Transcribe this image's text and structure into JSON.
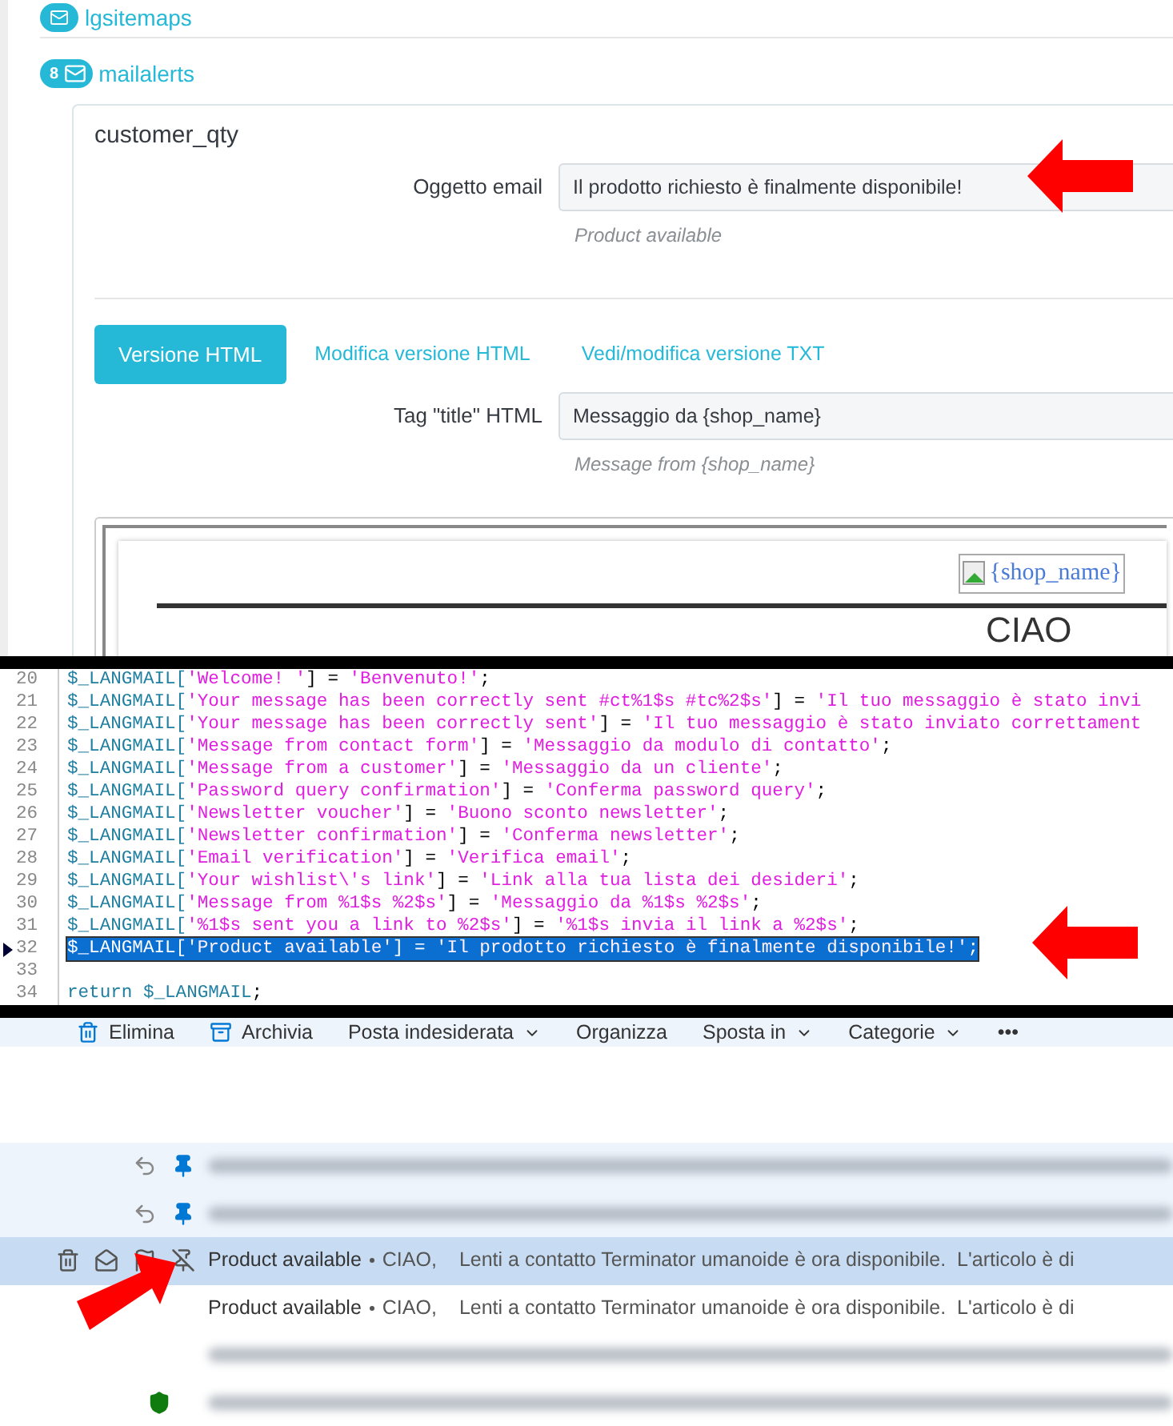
{
  "admin": {
    "modules": [
      {
        "name": "lgsitemaps"
      },
      {
        "name": "mailalerts",
        "count": "8"
      }
    ],
    "template": "customer_qty",
    "subject": {
      "label": "Oggetto email",
      "value": "Il prodotto richiesto è finalmente disponibile!",
      "hint": "Product available"
    },
    "tabs": [
      {
        "label": "Versione HTML",
        "selected": true
      },
      {
        "label": "Modifica versione HTML",
        "selected": false
      },
      {
        "label": "Vedi/modifica versione TXT",
        "selected": false
      }
    ],
    "title_tag": {
      "label": "Tag \"title\" HTML",
      "value": "Messaggio da {shop_name}",
      "hint": "Message from {shop_name}"
    },
    "preview": {
      "image_alt": "{shop_name}",
      "heading": "CIAO"
    }
  },
  "code": {
    "lines": [
      {
        "number": "20",
        "selected": false,
        "tokens": [
          {
            "kind": "var",
            "text": "$_LANGMAIL["
          },
          {
            "kind": "string",
            "text": "'Welcome! '"
          },
          {
            "kind": "punct",
            "text": "] = "
          },
          {
            "kind": "string",
            "text": "'Benvenuto!'"
          },
          {
            "kind": "punct",
            "text": ";"
          }
        ]
      },
      {
        "number": "21",
        "selected": false,
        "tokens": [
          {
            "kind": "var",
            "text": "$_LANGMAIL["
          },
          {
            "kind": "string",
            "text": "'Your message has been correctly sent #ct%1$s #tc%2$s'"
          },
          {
            "kind": "punct",
            "text": "] = "
          },
          {
            "kind": "string",
            "text": "'Il tuo messaggio è stato invi"
          }
        ]
      },
      {
        "number": "22",
        "selected": false,
        "tokens": [
          {
            "kind": "var",
            "text": "$_LANGMAIL["
          },
          {
            "kind": "string",
            "text": "'Your message has been correctly sent'"
          },
          {
            "kind": "punct",
            "text": "] = "
          },
          {
            "kind": "string",
            "text": "'Il tuo messaggio è stato inviato correttament"
          }
        ]
      },
      {
        "number": "23",
        "selected": false,
        "tokens": [
          {
            "kind": "var",
            "text": "$_LANGMAIL["
          },
          {
            "kind": "string",
            "text": "'Message from contact form'"
          },
          {
            "kind": "punct",
            "text": "] = "
          },
          {
            "kind": "string",
            "text": "'Messaggio da modulo di contatto'"
          },
          {
            "kind": "punct",
            "text": ";"
          }
        ]
      },
      {
        "number": "24",
        "selected": false,
        "tokens": [
          {
            "kind": "var",
            "text": "$_LANGMAIL["
          },
          {
            "kind": "string",
            "text": "'Message from a customer'"
          },
          {
            "kind": "punct",
            "text": "] = "
          },
          {
            "kind": "string",
            "text": "'Messaggio da un cliente'"
          },
          {
            "kind": "punct",
            "text": ";"
          }
        ]
      },
      {
        "number": "25",
        "selected": false,
        "tokens": [
          {
            "kind": "var",
            "text": "$_LANGMAIL["
          },
          {
            "kind": "string",
            "text": "'Password query confirmation'"
          },
          {
            "kind": "punct",
            "text": "] = "
          },
          {
            "kind": "string",
            "text": "'Conferma password query'"
          },
          {
            "kind": "punct",
            "text": ";"
          }
        ]
      },
      {
        "number": "26",
        "selected": false,
        "tokens": [
          {
            "kind": "var",
            "text": "$_LANGMAIL["
          },
          {
            "kind": "string",
            "text": "'Newsletter voucher'"
          },
          {
            "kind": "punct",
            "text": "] = "
          },
          {
            "kind": "string",
            "text": "'Buono sconto newsletter'"
          },
          {
            "kind": "punct",
            "text": ";"
          }
        ]
      },
      {
        "number": "27",
        "selected": false,
        "tokens": [
          {
            "kind": "var",
            "text": "$_LANGMAIL["
          },
          {
            "kind": "string",
            "text": "'Newsletter confirmation'"
          },
          {
            "kind": "punct",
            "text": "] = "
          },
          {
            "kind": "string",
            "text": "'Conferma newsletter'"
          },
          {
            "kind": "punct",
            "text": ";"
          }
        ]
      },
      {
        "number": "28",
        "selected": false,
        "tokens": [
          {
            "kind": "var",
            "text": "$_LANGMAIL["
          },
          {
            "kind": "string",
            "text": "'Email verification'"
          },
          {
            "kind": "punct",
            "text": "] = "
          },
          {
            "kind": "string",
            "text": "'Verifica email'"
          },
          {
            "kind": "punct",
            "text": ";"
          }
        ]
      },
      {
        "number": "29",
        "selected": false,
        "tokens": [
          {
            "kind": "var",
            "text": "$_LANGMAIL["
          },
          {
            "kind": "string",
            "text": "'Your wishlist\\'s link'"
          },
          {
            "kind": "punct",
            "text": "] = "
          },
          {
            "kind": "string",
            "text": "'Link alla tua lista dei desideri'"
          },
          {
            "kind": "punct",
            "text": ";"
          }
        ]
      },
      {
        "number": "30",
        "selected": false,
        "tokens": [
          {
            "kind": "var",
            "text": "$_LANGMAIL["
          },
          {
            "kind": "string",
            "text": "'Message from %1$s %2$s'"
          },
          {
            "kind": "punct",
            "text": "] = "
          },
          {
            "kind": "string",
            "text": "'Messaggio da %1$s %2$s'"
          },
          {
            "kind": "punct",
            "text": ";"
          }
        ]
      },
      {
        "number": "31",
        "selected": false,
        "tokens": [
          {
            "kind": "var",
            "text": "$_LANGMAIL["
          },
          {
            "kind": "string",
            "text": "'%1$s sent you a link to %2$s'"
          },
          {
            "kind": "punct",
            "text": "] = "
          },
          {
            "kind": "string",
            "text": "'%1$s invia il link a %2$s'"
          },
          {
            "kind": "punct",
            "text": ";"
          }
        ]
      },
      {
        "number": "32",
        "selected": true,
        "tokens": [
          {
            "kind": "var",
            "text": "$_LANGMAIL["
          },
          {
            "kind": "string",
            "text": "'Product available'"
          },
          {
            "kind": "punct",
            "text": "] = "
          },
          {
            "kind": "string",
            "text": "'Il prodotto richiesto è finalmente disponibile!'"
          },
          {
            "kind": "punct",
            "text": ";"
          }
        ]
      },
      {
        "number": "33",
        "selected": false
      },
      {
        "number": "34",
        "selected": false,
        "tokens": [
          {
            "kind": "var",
            "text": "return $_LANGMAIL"
          },
          {
            "kind": "punct",
            "text": ";"
          }
        ]
      }
    ]
  },
  "mail": {
    "toolbar": [
      {
        "label": "Elimina",
        "kind": "trash"
      },
      {
        "label": "Archivia",
        "kind": "archive"
      },
      {
        "label": "Posta indesiderata",
        "kind": "dropdown"
      },
      {
        "label": "Organizza",
        "kind": "plain"
      },
      {
        "label": "Sposta in",
        "kind": "dropdown"
      },
      {
        "label": "Categorie",
        "kind": "dropdown"
      },
      {
        "label": "•••",
        "kind": "plain"
      }
    ],
    "rows": [
      {
        "kind": "blurred",
        "pinned": true,
        "selected": false,
        "verified": false
      },
      {
        "kind": "blurred",
        "pinned": true,
        "selected": false,
        "verified": false
      },
      {
        "kind": "message",
        "pinned": false,
        "selected": true,
        "verified": false,
        "subject": "Product available",
        "sender": "CIAO,",
        "preview": "Lenti a contatto Terminator umanoide è ora disponibile.  L'articolo è di"
      },
      {
        "kind": "message",
        "pinned": false,
        "selected": false,
        "verified": false,
        "subject": "Product available",
        "sender": "CIAO,",
        "preview": "Lenti a contatto Terminator umanoide è ora disponibile.  L'articolo è di"
      },
      {
        "kind": "blurred",
        "pinned": false,
        "selected": false,
        "verified": false
      },
      {
        "kind": "blurred",
        "pinned": false,
        "selected": false,
        "verified": true
      }
    ]
  }
}
